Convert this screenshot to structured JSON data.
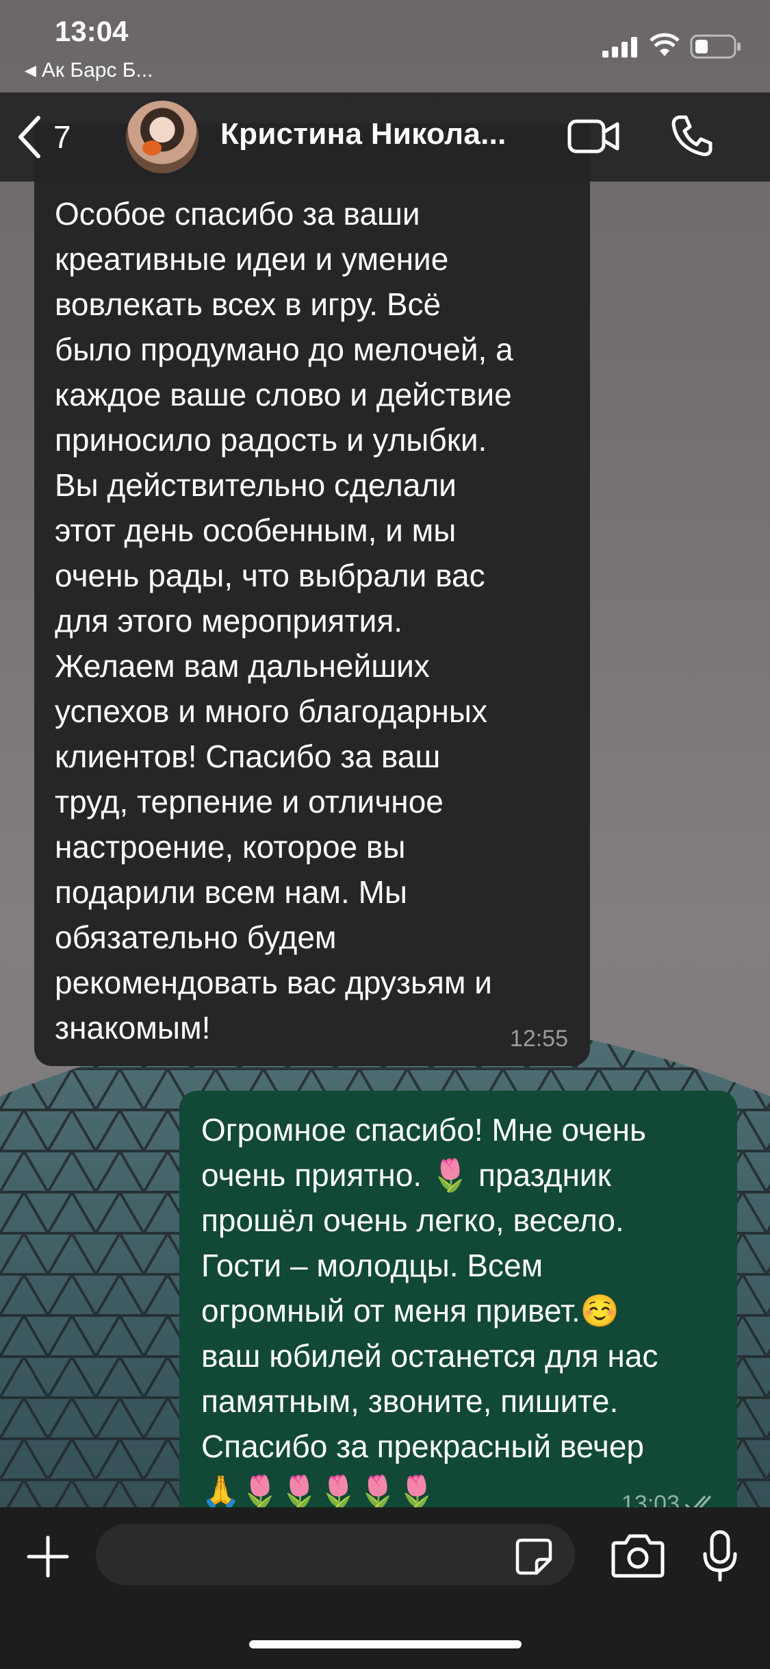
{
  "status_bar": {
    "time": "13:04",
    "back_app": "Ак Барс Б..."
  },
  "header": {
    "unread_count": "7",
    "contact_name": "Кристина Никола..."
  },
  "messages": {
    "incoming": {
      "text": "Особое спасибо за ваши\nкреативные идеи и умение\nвовлекать всех в игру. Всё\nбыло продумано до мелочей, а\nкаждое ваше слово и действие\nприносило радость и улыбки.\nВы действительно сделали\nэтот день особенным, и мы\nочень рады, что выбрали вас\nдля этого мероприятия.\nЖелаем вам дальнейших\nуспехов и много благодарных\nклиентов! Спасибо за ваш\nтруд, терпение и отличное\nнастроение, которое вы\nподарили всем нам. Мы\nобязательно будем\nрекомендовать вас друзьям и\nзнакомым!",
      "time": "12:55"
    },
    "outgoing": {
      "text": "Огромное спасибо! Мне очень\nочень приятно. 🌷 праздник\nпрошёл очень легко, весело.\nГости – молодцы. Всем\nогромный от меня привет.☺️\nваш юбилей останется для нас\nпамятным, звоните, пишите.\nСпасибо за прекрасный вечер\n🙏🌷🌷🌷🌷🌷",
      "time": "13:03",
      "status": "read"
    }
  },
  "input": {
    "placeholder": ""
  },
  "icons": {
    "back": "chevron-left-icon",
    "video": "video-camera-icon",
    "call": "phone-icon",
    "attach": "plus-icon",
    "sticker": "sticker-icon",
    "camera": "camera-icon",
    "mic": "microphone-icon"
  },
  "colors": {
    "incoming_bubble": "#262627",
    "outgoing_bubble": "#114836",
    "header_bg": "#242426",
    "input_bar_bg": "#1d1d1e"
  }
}
